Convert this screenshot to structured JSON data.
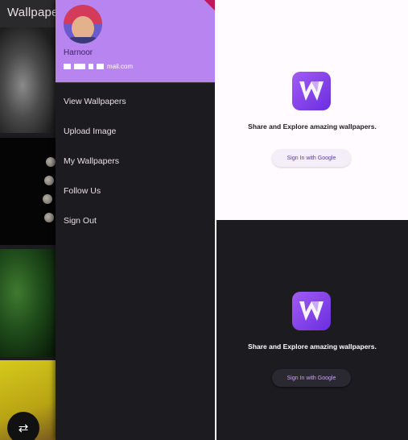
{
  "app": {
    "title": "Wallpapers"
  },
  "drawer": {
    "user_name": "Harnoor",
    "user_email_visible": "mail.com",
    "menu": [
      {
        "label": "View Wallpapers"
      },
      {
        "label": "Upload Image"
      },
      {
        "label": "My Wallpapers"
      },
      {
        "label": "Follow Us"
      },
      {
        "label": "Sign Out"
      }
    ]
  },
  "fab": {
    "icon": "swap-icon",
    "glyph": "⇄"
  },
  "signin_light": {
    "tagline": "Share and Explore amazing wallpapers.",
    "button_label": "Sign In with Google"
  },
  "signin_dark": {
    "tagline": "Share and Explore amazing wallpapers.",
    "button_label": "Sign In with Google"
  },
  "colors": {
    "drawer_header": "#b784f0",
    "accent": "#7c3aed",
    "dark_bg": "#1c1b1f",
    "light_bg": "#fffbfe"
  }
}
